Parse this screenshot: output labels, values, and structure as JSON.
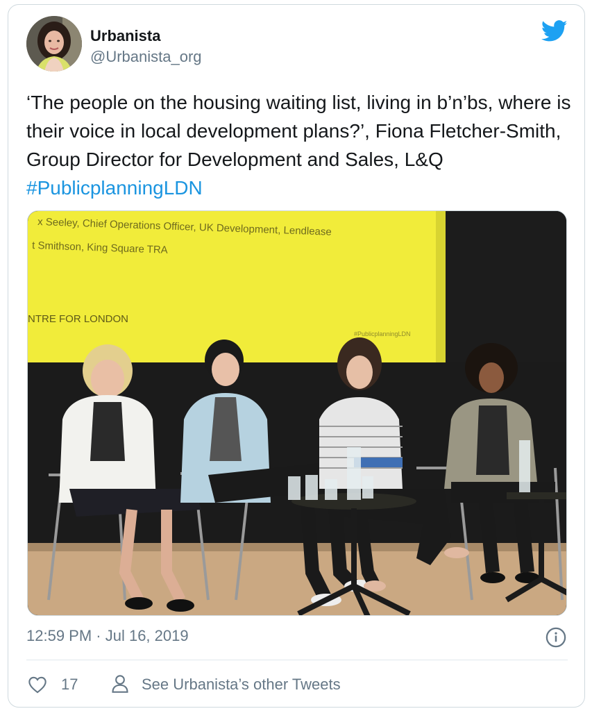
{
  "user": {
    "display_name": "Urbanista",
    "handle": "@Urbanista_org"
  },
  "tweet": {
    "text": "‘The people on the housing waiting list, living in b’n’bs, where is their voice in local development plans?’, Fiona Fletcher-Smith, Group Director for Development and Sales, L&Q ",
    "hashtag": "#PublicplanningLDN"
  },
  "media": {
    "screen_lines": [
      "x Seeley, Chief Operations Officer, UK Development, Lendlease",
      "t Smithson, King Square TRA"
    ],
    "screen_org": "NTRE FOR LONDON",
    "screen_hashtag": "#PublicplanningLDN"
  },
  "meta": {
    "timestamp": "12:59 PM · Jul 16, 2019",
    "like_count": "17",
    "see_other_label": "See Urbanista’s other Tweets"
  },
  "colors": {
    "text": "#14171a",
    "muted": "#657786",
    "accent": "#1b95e0",
    "border": "#cfd9de",
    "screen_yellow": "#f1ec3a"
  },
  "icons": [
    "twitter-bird-icon",
    "info-icon",
    "heart-icon",
    "person-icon"
  ]
}
